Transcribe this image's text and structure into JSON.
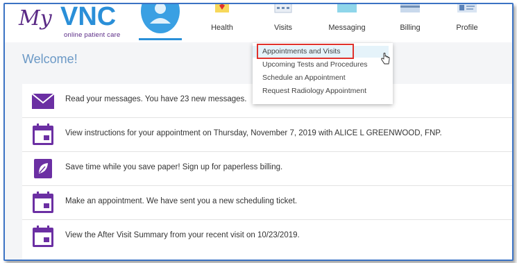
{
  "brand": {
    "logo_text": "MyVNC",
    "tagline": "online patient care"
  },
  "nav": {
    "items": [
      {
        "label": "Health",
        "icon": "health-icon"
      },
      {
        "label": "Visits",
        "icon": "calendar-icon"
      },
      {
        "label": "Messaging",
        "icon": "envelope-icon"
      },
      {
        "label": "Billing",
        "icon": "billing-icon"
      },
      {
        "label": "Profile",
        "icon": "id-card-icon"
      }
    ]
  },
  "visits_menu": {
    "items": [
      {
        "label": "Appointments and Visits",
        "highlighted": true
      },
      {
        "label": "Upcoming Tests and Procedures"
      },
      {
        "label": "Schedule an Appointment"
      },
      {
        "label": "Request Radiology Appointment"
      }
    ]
  },
  "main": {
    "welcome": "Welcome!",
    "notifications": [
      {
        "icon": "envelope-icon",
        "text": "Read your messages. You have 23 new messages."
      },
      {
        "icon": "calendar-icon",
        "text": "View instructions for your appointment on Thursday, November 7, 2019 with ALICE L GREENWOOD, FNP."
      },
      {
        "icon": "leaf-icon",
        "text": "Save time while you save paper! Sign up for paperless billing."
      },
      {
        "icon": "calendar-icon",
        "text": "Make an appointment. We have sent you a new scheduling ticket."
      },
      {
        "icon": "calendar-icon",
        "text": "View the After Visit Summary from your recent visit on 10/23/2019."
      }
    ]
  },
  "colors": {
    "brand_purple": "#5a2a86",
    "icon_purple": "#6b2fa3",
    "link_blue": "#2a8fd8",
    "frame_blue": "#3b73c4",
    "highlight_red": "#e0322c"
  }
}
